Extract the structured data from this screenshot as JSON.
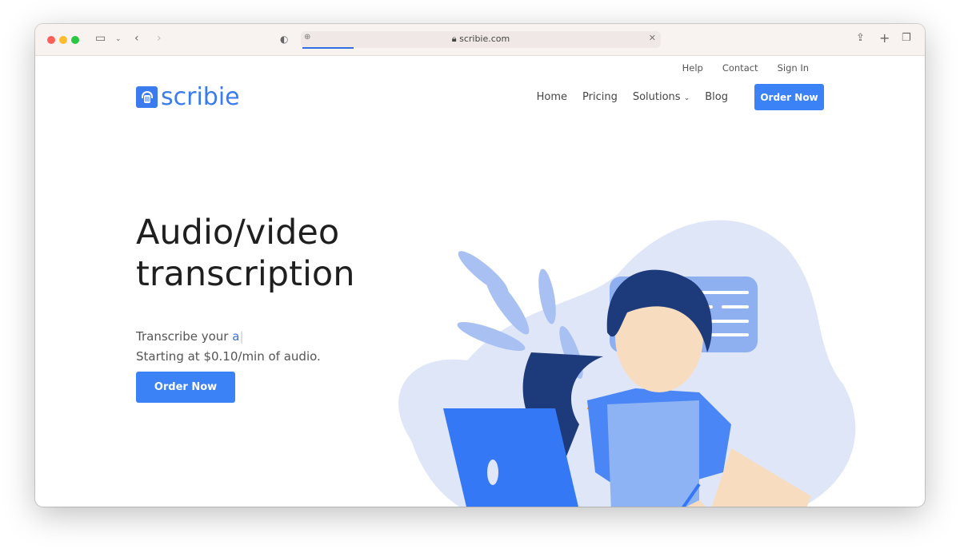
{
  "browser": {
    "url": "scribie.com",
    "colors": {
      "close": "#ff5f57",
      "minimize": "#febc2e",
      "zoom": "#28c840"
    }
  },
  "top_links": [
    "Help",
    "Contact",
    "Sign In"
  ],
  "logo": "scribie",
  "nav": {
    "items": [
      "Home",
      "Pricing",
      "Solutions",
      "Blog"
    ],
    "cta": "Order Now"
  },
  "hero": {
    "title_line1": "Audio/video",
    "title_line2": "transcription",
    "typed": "Transcribe your ",
    "typed_accent": "a",
    "price": "Starting at $0.10/min of audio.",
    "cta": "Order Now"
  },
  "colors": {
    "accent": "#3b82f6"
  }
}
